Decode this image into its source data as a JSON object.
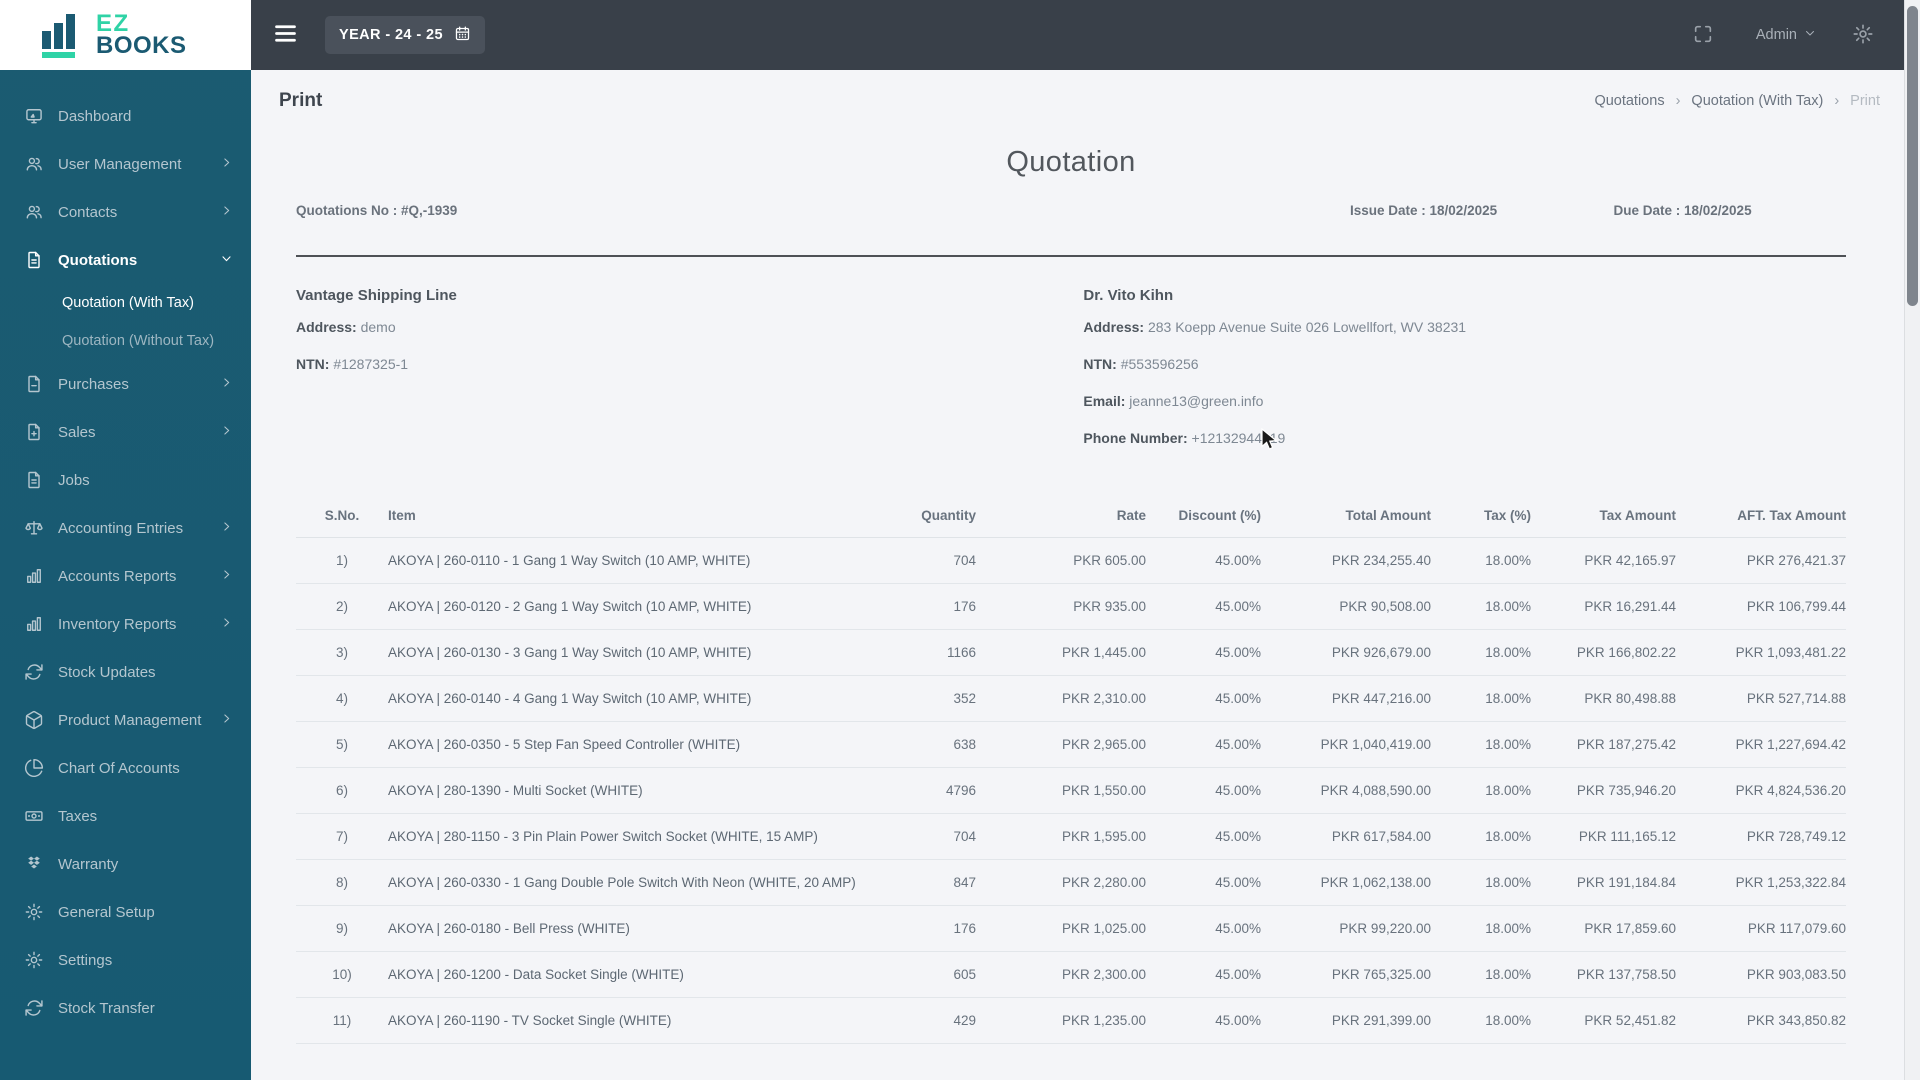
{
  "brand": {
    "line1": "EZ",
    "line2": "BOOKS"
  },
  "colors": {
    "accent": "#2fd3a6",
    "sidebar": "#185a71",
    "topbar": "#394049",
    "page_background": "#f4f5f8"
  },
  "topbar": {
    "year_selector": "YEAR - 24 - 25",
    "admin_label": "Admin"
  },
  "page": {
    "title": "Print"
  },
  "breadcrumb": [
    {
      "label": "Quotations",
      "active": false
    },
    {
      "label": "Quotation (With Tax)",
      "active": false
    },
    {
      "label": "Print",
      "active": true
    }
  ],
  "sidebar": {
    "items": [
      {
        "icon": "dashboard",
        "label": "Dashboard"
      },
      {
        "icon": "user-group",
        "label": "User Management",
        "chevron": "right"
      },
      {
        "icon": "user-group",
        "label": "Contacts",
        "chevron": "right"
      },
      {
        "icon": "file-text",
        "label": "Quotations",
        "chevron": "down",
        "active": true,
        "children": [
          {
            "label": "Quotation (With Tax)",
            "active": true
          },
          {
            "label": "Quotation (Without Tax)",
            "active": false
          }
        ]
      },
      {
        "icon": "file-minus",
        "label": "Purchases",
        "chevron": "right"
      },
      {
        "icon": "file-plus",
        "label": "Sales",
        "chevron": "right"
      },
      {
        "icon": "file-text",
        "label": "Jobs"
      },
      {
        "icon": "scale",
        "label": "Accounting Entries",
        "chevron": "right"
      },
      {
        "icon": "bar-chart",
        "label": "Accounts Reports",
        "chevron": "right"
      },
      {
        "icon": "bar-chart",
        "label": "Inventory Reports",
        "chevron": "right"
      },
      {
        "icon": "refresh",
        "label": "Stock Updates"
      },
      {
        "icon": "package",
        "label": "Product Management",
        "chevron": "right"
      },
      {
        "icon": "pie-chart",
        "label": "Chart Of Accounts"
      },
      {
        "icon": "banknote",
        "label": "Taxes"
      },
      {
        "icon": "warranty",
        "label": "Warranty"
      },
      {
        "icon": "gear",
        "label": "General Setup"
      },
      {
        "icon": "gear",
        "label": "Settings"
      },
      {
        "icon": "refresh",
        "label": "Stock Transfer"
      }
    ]
  },
  "document": {
    "title": "Quotation",
    "meta": {
      "quotation_no": "Quotations No : #Q,-1939",
      "issue_date": "Issue Date : 18/02/2025",
      "due_date": "Due Date : 18/02/2025"
    },
    "company": {
      "name": "Vantage Shipping Line",
      "fields": [
        {
          "label": "Address:",
          "value": "demo"
        },
        {
          "label": "NTN:",
          "value": "#1287325-1"
        }
      ]
    },
    "customer": {
      "name": "Dr. Vito Kihn",
      "fields": [
        {
          "label": "Address:",
          "value": "283 Koepp Avenue Suite 026 Lowellfort, WV 38231"
        },
        {
          "label": "NTN:",
          "value": "#553596256"
        },
        {
          "label": "Email:",
          "value": "jeanne13@green.info"
        },
        {
          "label": "Phone Number:",
          "value": "+12132944419"
        }
      ]
    },
    "table": {
      "headers": [
        {
          "label": "S.No.",
          "align": "center"
        },
        {
          "label": "Item",
          "align": "left"
        },
        {
          "label": "Quantity",
          "align": "right"
        },
        {
          "label": "Rate",
          "align": "right"
        },
        {
          "label": "Discount (%)",
          "align": "right"
        },
        {
          "label": "Total Amount",
          "align": "right"
        },
        {
          "label": "Tax (%)",
          "align": "right"
        },
        {
          "label": "Tax Amount",
          "align": "right"
        },
        {
          "label": "AFT. Tax Amount",
          "align": "right"
        }
      ],
      "rows": [
        [
          "1)",
          "AKOYA | 260-0110 - 1 Gang 1 Way Switch (10 AMP, WHITE)",
          "704",
          "PKR 605.00",
          "45.00%",
          "PKR 234,255.40",
          "18.00%",
          "PKR 42,165.97",
          "PKR 276,421.37"
        ],
        [
          "2)",
          "AKOYA | 260-0120 - 2 Gang 1 Way Switch (10 AMP, WHITE)",
          "176",
          "PKR 935.00",
          "45.00%",
          "PKR 90,508.00",
          "18.00%",
          "PKR 16,291.44",
          "PKR 106,799.44"
        ],
        [
          "3)",
          "AKOYA | 260-0130 - 3 Gang 1 Way Switch (10 AMP, WHITE)",
          "1166",
          "PKR 1,445.00",
          "45.00%",
          "PKR 926,679.00",
          "18.00%",
          "PKR 166,802.22",
          "PKR 1,093,481.22"
        ],
        [
          "4)",
          "AKOYA | 260-0140 - 4 Gang 1 Way Switch (10 AMP, WHITE)",
          "352",
          "PKR 2,310.00",
          "45.00%",
          "PKR 447,216.00",
          "18.00%",
          "PKR 80,498.88",
          "PKR 527,714.88"
        ],
        [
          "5)",
          "AKOYA | 260-0350 - 5 Step Fan Speed Controller (WHITE)",
          "638",
          "PKR 2,965.00",
          "45.00%",
          "PKR 1,040,419.00",
          "18.00%",
          "PKR 187,275.42",
          "PKR 1,227,694.42"
        ],
        [
          "6)",
          "AKOYA | 280-1390 - Multi Socket (WHITE)",
          "4796",
          "PKR 1,550.00",
          "45.00%",
          "PKR 4,088,590.00",
          "18.00%",
          "PKR 735,946.20",
          "PKR 4,824,536.20"
        ],
        [
          "7)",
          "AKOYA | 280-1150 - 3 Pin Plain Power Switch Socket (WHITE, 15 AMP)",
          "704",
          "PKR 1,595.00",
          "45.00%",
          "PKR 617,584.00",
          "18.00%",
          "PKR 111,165.12",
          "PKR 728,749.12"
        ],
        [
          "8)",
          "AKOYA | 260-0330 - 1 Gang Double Pole Switch With Neon (WHITE, 20 AMP)",
          "847",
          "PKR 2,280.00",
          "45.00%",
          "PKR 1,062,138.00",
          "18.00%",
          "PKR 191,184.84",
          "PKR 1,253,322.84"
        ],
        [
          "9)",
          "AKOYA | 260-0180 - Bell Press (WHITE)",
          "176",
          "PKR 1,025.00",
          "45.00%",
          "PKR 99,220.00",
          "18.00%",
          "PKR 17,859.60",
          "PKR 117,079.60"
        ],
        [
          "10)",
          "AKOYA | 260-1200 - Data Socket Single (WHITE)",
          "605",
          "PKR 2,300.00",
          "45.00%",
          "PKR 765,325.00",
          "18.00%",
          "PKR 137,758.50",
          "PKR 903,083.50"
        ],
        [
          "11)",
          "AKOYA | 260-1190 - TV Socket Single (WHITE)",
          "429",
          "PKR 1,235.00",
          "45.00%",
          "PKR 291,399.00",
          "18.00%",
          "PKR 52,451.82",
          "PKR 343,850.82"
        ]
      ]
    }
  }
}
